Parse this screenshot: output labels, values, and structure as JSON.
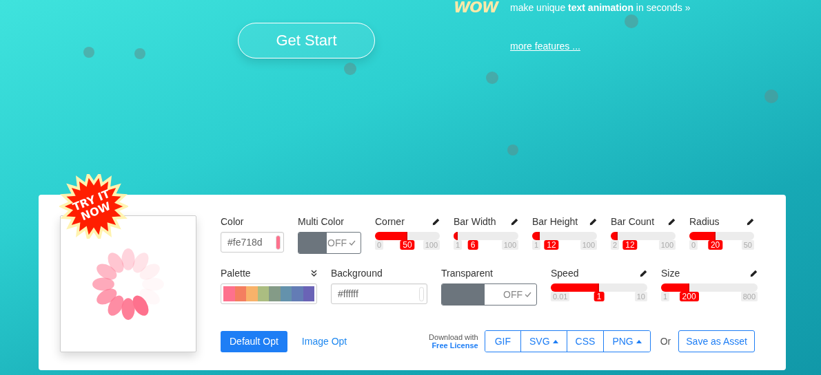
{
  "hero": {
    "logo_text": "WOW",
    "tagline": "make unique **text animation** in seconds »",
    "cta": "Get Start",
    "link": "more features ..."
  },
  "badge": "TRY IT NOW",
  "row_1": [
    {
      "kind": "color",
      "label": "Color",
      "value": "#fe718d"
    },
    {
      "kind": "toggle",
      "label": "Multi Color",
      "state_text": "OFF",
      "on": false
    },
    {
      "kind": "slider",
      "label": "Corner",
      "min": "0",
      "max": "100",
      "value": "50",
      "level": 0.5
    },
    {
      "kind": "slider",
      "label": "Bar Width",
      "min": "1",
      "max": "100",
      "value": "6",
      "level": 0.06
    },
    {
      "kind": "slider",
      "label": "Bar Height",
      "min": "1",
      "max": "100",
      "value": "12",
      "level": 0.12
    },
    {
      "kind": "slider",
      "label": "Bar Count",
      "min": "2",
      "max": "100",
      "value": "12",
      "level": 0.11
    },
    {
      "kind": "slider",
      "label": "Radius",
      "min": "0",
      "max": "50",
      "value": "20",
      "level": 0.4
    }
  ],
  "row_2": [
    {
      "kind": "palette",
      "label": "Palette",
      "colors": [
        {
          "color": "#fe718d"
        },
        {
          "color": "#f47e60"
        },
        {
          "color": "#f8b26a"
        },
        {
          "color": "#abbd81"
        },
        {
          "color": "#849b87"
        },
        {
          "color": "#6492ac"
        },
        {
          "color": "#637cb5"
        },
        {
          "color": "#6a63b6"
        }
      ]
    },
    {
      "kind": "color",
      "label": "Background",
      "value": "#ffffff"
    },
    {
      "kind": "toggle",
      "label": "Transparent",
      "state_text": "OFF",
      "on": false
    },
    {
      "kind": "slider",
      "label": "Speed",
      "min": "0.01",
      "max": "10",
      "value": "1",
      "level": 0.5
    },
    {
      "kind": "slider",
      "label": "Size",
      "min": "1",
      "max": "800",
      "value": "200",
      "level": 0.29
    }
  ],
  "options": [
    {
      "label": "Default Opt",
      "selected": true
    },
    {
      "label": "Image Opt",
      "selected": false
    }
  ],
  "download": {
    "note": "Download with",
    "license": "Free License",
    "formats": [
      {
        "label": "GIF",
        "menu": false
      },
      {
        "label": "SVG",
        "menu": true
      },
      {
        "label": "CSS",
        "menu": false
      },
      {
        "label": "PNG",
        "menu": true
      }
    ],
    "or": "Or",
    "save": "Save as Asset"
  }
}
